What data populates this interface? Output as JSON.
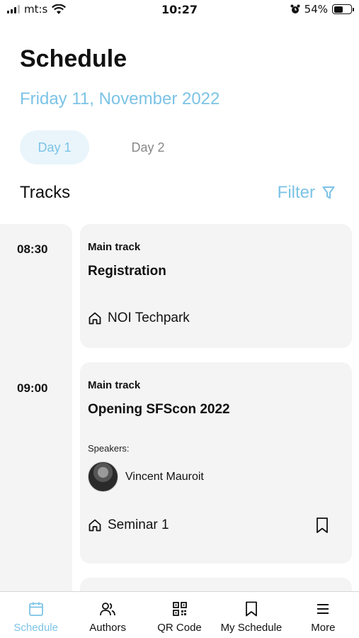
{
  "status_bar": {
    "carrier": "mt:s",
    "time": "10:27",
    "battery_percent": "54%",
    "battery_level": 0.54,
    "icons": [
      "signal-icon",
      "wifi-icon",
      "alarm-icon",
      "battery-icon"
    ]
  },
  "header": {
    "title": "Schedule",
    "date": "Friday 11, November 2022"
  },
  "day_tabs": [
    {
      "label": "Day 1",
      "active": true
    },
    {
      "label": "Day 2",
      "active": false
    }
  ],
  "tracks": {
    "label": "Tracks",
    "filter_label": "Filter"
  },
  "sessions": [
    {
      "time": "08:30",
      "track": "Main track",
      "title": "Registration",
      "location": "NOI Techpark"
    },
    {
      "time": "09:00",
      "track": "Main track",
      "title": "Opening SFScon 2022",
      "speakers_label": "Speakers:",
      "speaker_name": "Vincent Mauroit",
      "location": "Seminar 1"
    }
  ],
  "tab_bar": [
    {
      "label": "Schedule",
      "icon": "calendar-icon",
      "active": true
    },
    {
      "label": "Authors",
      "icon": "people-icon",
      "active": false
    },
    {
      "label": "QR Code",
      "icon": "qr-code-icon",
      "active": false
    },
    {
      "label": "My Schedule",
      "icon": "bookmark-icon",
      "active": false
    },
    {
      "label": "More",
      "icon": "menu-icon",
      "active": false
    }
  ],
  "colors": {
    "accent": "#7cc3e6",
    "card_background": "#f4f4f4",
    "active_tab_background": "#e9f5fb"
  }
}
